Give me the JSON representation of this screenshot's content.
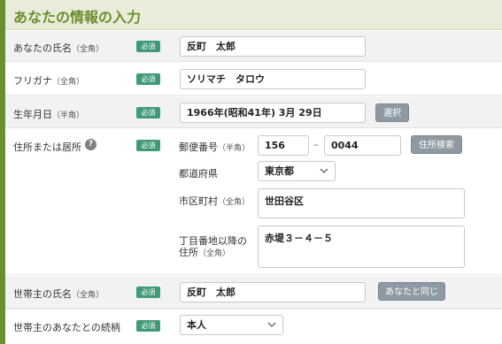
{
  "header": {
    "title": "あなたの情報の入力"
  },
  "required_badge": "必須",
  "fields": {
    "name": {
      "label": "あなたの氏名",
      "note": "（全角）",
      "value": "反町　太郎"
    },
    "furigana": {
      "label": "フリガナ",
      "note": "（全角）",
      "value": "ソリマチ　タロウ"
    },
    "birthdate": {
      "label": "生年月日",
      "note": "（半角）",
      "value": "1966年(昭和41年) 3月 29日",
      "button": "選択"
    },
    "address": {
      "label": "住所または居所",
      "help_icon": "?",
      "postal_label": "郵便番号",
      "postal_note": "（半角）",
      "postal_1": "156",
      "postal_dash": "–",
      "postal_2": "0044",
      "search_button": "住所検索",
      "pref_label": "都道府県",
      "pref_value": "東京都",
      "city_label": "市区町村",
      "city_note": "（全角）",
      "city_value": "世田谷区",
      "street_label_1": "丁目番地以降の",
      "street_label_2": "住所",
      "street_note": "（全角）",
      "street_value": "赤堤３－４－５"
    },
    "householder": {
      "label": "世帯主の氏名",
      "note": "（全角）",
      "value": "反町　太郎",
      "button": "あなたと同じ"
    },
    "relation": {
      "label": "世帯主のあなたとの続柄",
      "value": "本人"
    }
  },
  "colors": {
    "accent": "#6b8e2f",
    "required": "#3f9a78",
    "button": "#8e9aa3",
    "header_bg": "#e9ecd9"
  }
}
